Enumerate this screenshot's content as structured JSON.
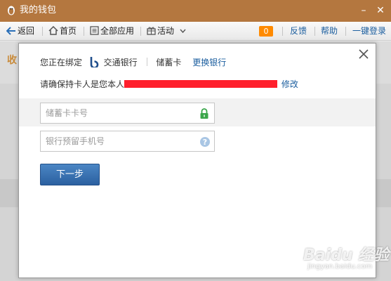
{
  "window": {
    "title": "我的钱包",
    "min_label": "–",
    "close_label": "✕"
  },
  "toolbar": {
    "back": "返回",
    "home": "首页",
    "all_apps": "全部应用",
    "activity": "活动",
    "badge_count": "0",
    "feedback": "反馈",
    "help": "帮助",
    "login": "一键登录"
  },
  "background": {
    "glyph": "收"
  },
  "dialog": {
    "binding_prefix": "您正在绑定",
    "bank_name": "交通银行",
    "card_type": "储蓄卡",
    "change_bank": "更换银行",
    "holder_prefix": "请确保持卡人是您本人",
    "modify": "修改",
    "card_number_placeholder": "储蓄卡卡号",
    "phone_placeholder": "银行预留手机号",
    "next_button": "下一步"
  },
  "watermark": {
    "text": "Baidu 经验",
    "url": "jingyan.baidu.com"
  },
  "colors": {
    "titlebar": "#b4773f",
    "accent": "#1a5d9e",
    "button": "#2b60a0",
    "badge": "#ff8a00",
    "redaction": "#ff1f2c",
    "lock": "#3aa64a"
  }
}
